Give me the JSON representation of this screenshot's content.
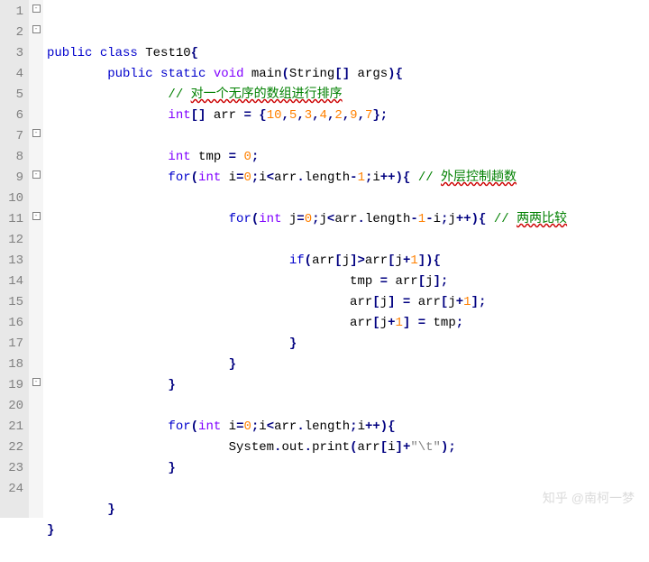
{
  "lineCount": 24,
  "folds": {
    "1": "-",
    "2": "-",
    "3": "",
    "4": "",
    "5": "",
    "6": "",
    "7": "-",
    "8": "",
    "9": "-",
    "10": "",
    "11": "-",
    "12": "",
    "13": "",
    "14": "",
    "15": "",
    "16": "",
    "17": "",
    "18": "",
    "19": "-",
    "20": "",
    "21": "",
    "22": "",
    "23": "",
    "24": ""
  },
  "tokens": {
    "1": [
      [
        "kw",
        "public"
      ],
      [
        "",
        " "
      ],
      [
        "kw",
        "class"
      ],
      [
        "",
        " Test10"
      ],
      [
        "op",
        "{"
      ]
    ],
    "2": [
      [
        "",
        "        "
      ],
      [
        "kw",
        "public"
      ],
      [
        "",
        " "
      ],
      [
        "kw",
        "static"
      ],
      [
        "",
        " "
      ],
      [
        "type",
        "void"
      ],
      [
        "",
        " main"
      ],
      [
        "op",
        "("
      ],
      [
        "",
        "String"
      ],
      [
        "op",
        "["
      ],
      [
        "op",
        "]"
      ],
      [
        "",
        " args"
      ],
      [
        "op",
        ")"
      ],
      [
        "op",
        "{"
      ]
    ],
    "3": [
      [
        "",
        "                "
      ],
      [
        "cmt",
        "// "
      ],
      [
        "cmt wavy",
        "对一个无序的数组进行排序"
      ]
    ],
    "4": [
      [
        "",
        "                "
      ],
      [
        "type",
        "int"
      ],
      [
        "op",
        "["
      ],
      [
        "op",
        "]"
      ],
      [
        "",
        " arr "
      ],
      [
        "op",
        "="
      ],
      [
        "",
        " "
      ],
      [
        "op",
        "{"
      ],
      [
        "num",
        "10"
      ],
      [
        "op",
        ","
      ],
      [
        "num",
        "5"
      ],
      [
        "op",
        ","
      ],
      [
        "num",
        "3"
      ],
      [
        "op",
        ","
      ],
      [
        "num",
        "4"
      ],
      [
        "op",
        ","
      ],
      [
        "num",
        "2"
      ],
      [
        "op",
        ","
      ],
      [
        "num",
        "9"
      ],
      [
        "op",
        ","
      ],
      [
        "num",
        "7"
      ],
      [
        "op",
        "}"
      ],
      [
        "op",
        ";"
      ]
    ],
    "5": [
      [
        "",
        ""
      ]
    ],
    "6": [
      [
        "",
        "                "
      ],
      [
        "type",
        "int"
      ],
      [
        "",
        " tmp "
      ],
      [
        "op",
        "="
      ],
      [
        "",
        " "
      ],
      [
        "num",
        "0"
      ],
      [
        "op",
        ";"
      ]
    ],
    "7": [
      [
        "",
        "                "
      ],
      [
        "kw",
        "for"
      ],
      [
        "op",
        "("
      ],
      [
        "type",
        "int"
      ],
      [
        "",
        " i"
      ],
      [
        "op",
        "="
      ],
      [
        "num",
        "0"
      ],
      [
        "op",
        ";"
      ],
      [
        "",
        "i"
      ],
      [
        "op",
        "<"
      ],
      [
        "",
        "arr"
      ],
      [
        "op",
        "."
      ],
      [
        "",
        "length"
      ],
      [
        "op",
        "-"
      ],
      [
        "num",
        "1"
      ],
      [
        "op",
        ";"
      ],
      [
        "",
        "i"
      ],
      [
        "op",
        "++"
      ],
      [
        "op",
        ")"
      ],
      [
        "op",
        "{"
      ],
      [
        "",
        " "
      ],
      [
        "cmt",
        "// "
      ],
      [
        "cmt wavy",
        "外层控制趟数"
      ]
    ],
    "8": [
      [
        "",
        ""
      ]
    ],
    "9": [
      [
        "",
        "                        "
      ],
      [
        "kw",
        "for"
      ],
      [
        "op",
        "("
      ],
      [
        "type",
        "int"
      ],
      [
        "",
        " j"
      ],
      [
        "op",
        "="
      ],
      [
        "num",
        "0"
      ],
      [
        "op",
        ";"
      ],
      [
        "",
        "j"
      ],
      [
        "op",
        "<"
      ],
      [
        "",
        "arr"
      ],
      [
        "op",
        "."
      ],
      [
        "",
        "length"
      ],
      [
        "op",
        "-"
      ],
      [
        "num",
        "1"
      ],
      [
        "op",
        "-"
      ],
      [
        "",
        "i"
      ],
      [
        "op",
        ";"
      ],
      [
        "",
        "j"
      ],
      [
        "op",
        "++"
      ],
      [
        "op",
        ")"
      ],
      [
        "op",
        "{"
      ],
      [
        "",
        " "
      ],
      [
        "cmt",
        "// "
      ],
      [
        "cmt wavy",
        "两两比较"
      ]
    ],
    "10": [
      [
        "",
        ""
      ]
    ],
    "11": [
      [
        "",
        "                                "
      ],
      [
        "kw",
        "if"
      ],
      [
        "op",
        "("
      ],
      [
        "",
        "arr"
      ],
      [
        "op",
        "["
      ],
      [
        "",
        "j"
      ],
      [
        "op",
        "]"
      ],
      [
        "op",
        ">"
      ],
      [
        "",
        "arr"
      ],
      [
        "op",
        "["
      ],
      [
        "",
        "j"
      ],
      [
        "op",
        "+"
      ],
      [
        "num",
        "1"
      ],
      [
        "op",
        "]"
      ],
      [
        "op",
        ")"
      ],
      [
        "op",
        "{"
      ]
    ],
    "12": [
      [
        "",
        "                                        tmp "
      ],
      [
        "op",
        "="
      ],
      [
        "",
        " arr"
      ],
      [
        "op",
        "["
      ],
      [
        "",
        "j"
      ],
      [
        "op",
        "]"
      ],
      [
        "op",
        ";"
      ]
    ],
    "13": [
      [
        "",
        "                                        arr"
      ],
      [
        "op",
        "["
      ],
      [
        "",
        "j"
      ],
      [
        "op",
        "]"
      ],
      [
        "",
        " "
      ],
      [
        "op",
        "="
      ],
      [
        "",
        " arr"
      ],
      [
        "op",
        "["
      ],
      [
        "",
        "j"
      ],
      [
        "op",
        "+"
      ],
      [
        "num",
        "1"
      ],
      [
        "op",
        "]"
      ],
      [
        "op",
        ";"
      ]
    ],
    "14": [
      [
        "",
        "                                        arr"
      ],
      [
        "op",
        "["
      ],
      [
        "",
        "j"
      ],
      [
        "op",
        "+"
      ],
      [
        "num",
        "1"
      ],
      [
        "op",
        "]"
      ],
      [
        "",
        " "
      ],
      [
        "op",
        "="
      ],
      [
        "",
        " tmp"
      ],
      [
        "op",
        ";"
      ]
    ],
    "15": [
      [
        "",
        "                                "
      ],
      [
        "op",
        "}"
      ]
    ],
    "16": [
      [
        "",
        "                        "
      ],
      [
        "op",
        "}"
      ]
    ],
    "17": [
      [
        "",
        "                "
      ],
      [
        "op",
        "}"
      ]
    ],
    "18": [
      [
        "",
        ""
      ]
    ],
    "19": [
      [
        "",
        "                "
      ],
      [
        "kw",
        "for"
      ],
      [
        "op",
        "("
      ],
      [
        "type",
        "int"
      ],
      [
        "",
        " i"
      ],
      [
        "op",
        "="
      ],
      [
        "num",
        "0"
      ],
      [
        "op",
        ";"
      ],
      [
        "",
        "i"
      ],
      [
        "op",
        "<"
      ],
      [
        "",
        "arr"
      ],
      [
        "op",
        "."
      ],
      [
        "",
        "length"
      ],
      [
        "op",
        ";"
      ],
      [
        "",
        "i"
      ],
      [
        "op",
        "++"
      ],
      [
        "op",
        ")"
      ],
      [
        "op",
        "{"
      ]
    ],
    "20": [
      [
        "",
        "                        System"
      ],
      [
        "op",
        "."
      ],
      [
        "",
        "out"
      ],
      [
        "op",
        "."
      ],
      [
        "",
        "print"
      ],
      [
        "op",
        "("
      ],
      [
        "",
        "arr"
      ],
      [
        "op",
        "["
      ],
      [
        "",
        "i"
      ],
      [
        "op",
        "]"
      ],
      [
        "op",
        "+"
      ],
      [
        "str",
        "\"\\t\""
      ],
      [
        "op",
        ")"
      ],
      [
        "op",
        ";"
      ]
    ],
    "21": [
      [
        "",
        "                "
      ],
      [
        "op",
        "}"
      ]
    ],
    "22": [
      [
        "",
        ""
      ]
    ],
    "23": [
      [
        "",
        "        "
      ],
      [
        "op",
        "}"
      ]
    ],
    "24": [
      [
        "op",
        "}"
      ]
    ]
  },
  "watermark": "知乎 @南柯一梦"
}
